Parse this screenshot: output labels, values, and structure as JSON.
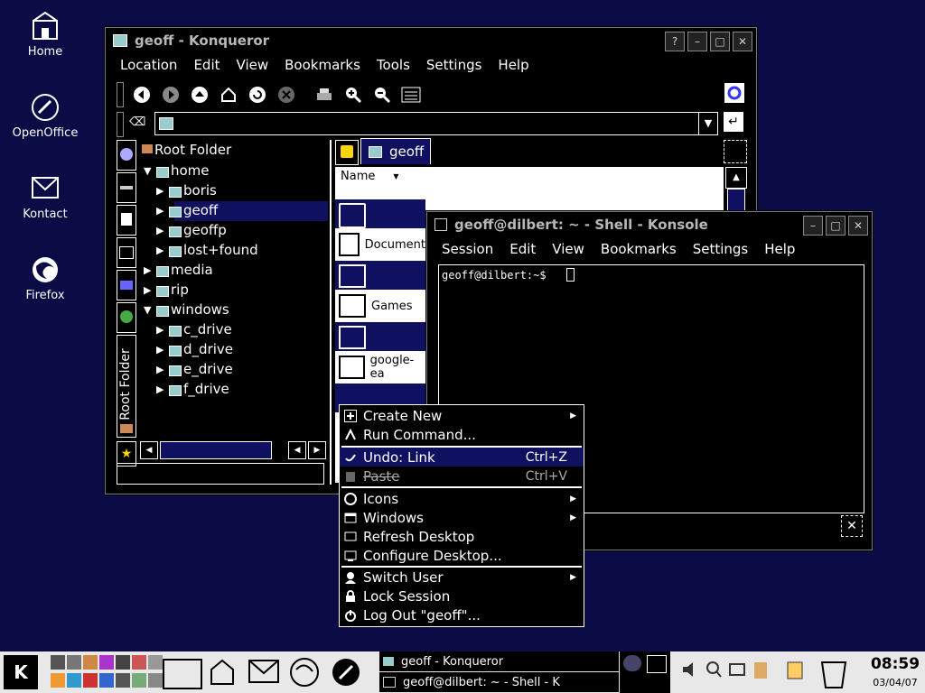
{
  "desktop": {
    "icons": [
      {
        "label": "Home",
        "icon": "home-folder-icon"
      },
      {
        "label": "OpenOffice",
        "icon": "openoffice-icon"
      },
      {
        "label": "Kontact",
        "icon": "kontact-icon"
      },
      {
        "label": "Firefox",
        "icon": "firefox-icon"
      }
    ]
  },
  "konqueror": {
    "title": "geoff - Konqueror",
    "menu": [
      "Location",
      "Edit",
      "View",
      "Bookmarks",
      "Tools",
      "Settings",
      "Help"
    ],
    "location_value": "",
    "tree_root": "Root Folder",
    "tree": [
      {
        "label": "home",
        "level": 1,
        "expanded": true
      },
      {
        "label": "boris",
        "level": 2
      },
      {
        "label": "geoff",
        "level": 2,
        "selected": true
      },
      {
        "label": "geoffp",
        "level": 2
      },
      {
        "label": "lost+found",
        "level": 2
      },
      {
        "label": "media",
        "level": 1
      },
      {
        "label": "rip",
        "level": 1
      },
      {
        "label": "windows",
        "level": 1,
        "expanded": true
      },
      {
        "label": "c_drive",
        "level": 2
      },
      {
        "label": "d_drive",
        "level": 2
      },
      {
        "label": "e_drive",
        "level": 2
      },
      {
        "label": "f_drive",
        "level": 2
      }
    ],
    "sidebar_tab_label": "Root Folder",
    "tab_label": "geoff",
    "column_name": "Name",
    "files": [
      "Document",
      "Games",
      "google-ea"
    ]
  },
  "konsole": {
    "title": "geoff@dilbert: ~ - Shell - Konsole",
    "menu": [
      "Session",
      "Edit",
      "View",
      "Bookmarks",
      "Settings",
      "Help"
    ],
    "prompt": "geoff@dilbert:~$ "
  },
  "context_menu": {
    "items": [
      {
        "label": "Create New",
        "submenu": true
      },
      {
        "label": "Run Command...",
        "submenu": false
      },
      {
        "label": "Undo: Link",
        "shortcut": "Ctrl+Z",
        "highlighted": true
      },
      {
        "label": "Paste",
        "shortcut": "Ctrl+V",
        "disabled": true
      },
      {
        "label": "Icons",
        "submenu": true
      },
      {
        "label": "Windows",
        "submenu": true
      },
      {
        "label": "Refresh Desktop"
      },
      {
        "label": "Configure Desktop..."
      },
      {
        "label": "Switch User",
        "submenu": true
      },
      {
        "label": "Lock Session"
      },
      {
        "label": "Log Out \"geoff\"..."
      }
    ]
  },
  "taskbar": {
    "tasks": [
      "geoff - Konqueror",
      "geoff@dilbert: ~ - Shell - K"
    ],
    "clock_time": "08:59",
    "clock_date": "03/04/07"
  },
  "colors": {
    "desktop": "#0b0c45",
    "highlight": "#101060",
    "window_bg": "#000000",
    "taskbar": "#e8e8e8"
  }
}
